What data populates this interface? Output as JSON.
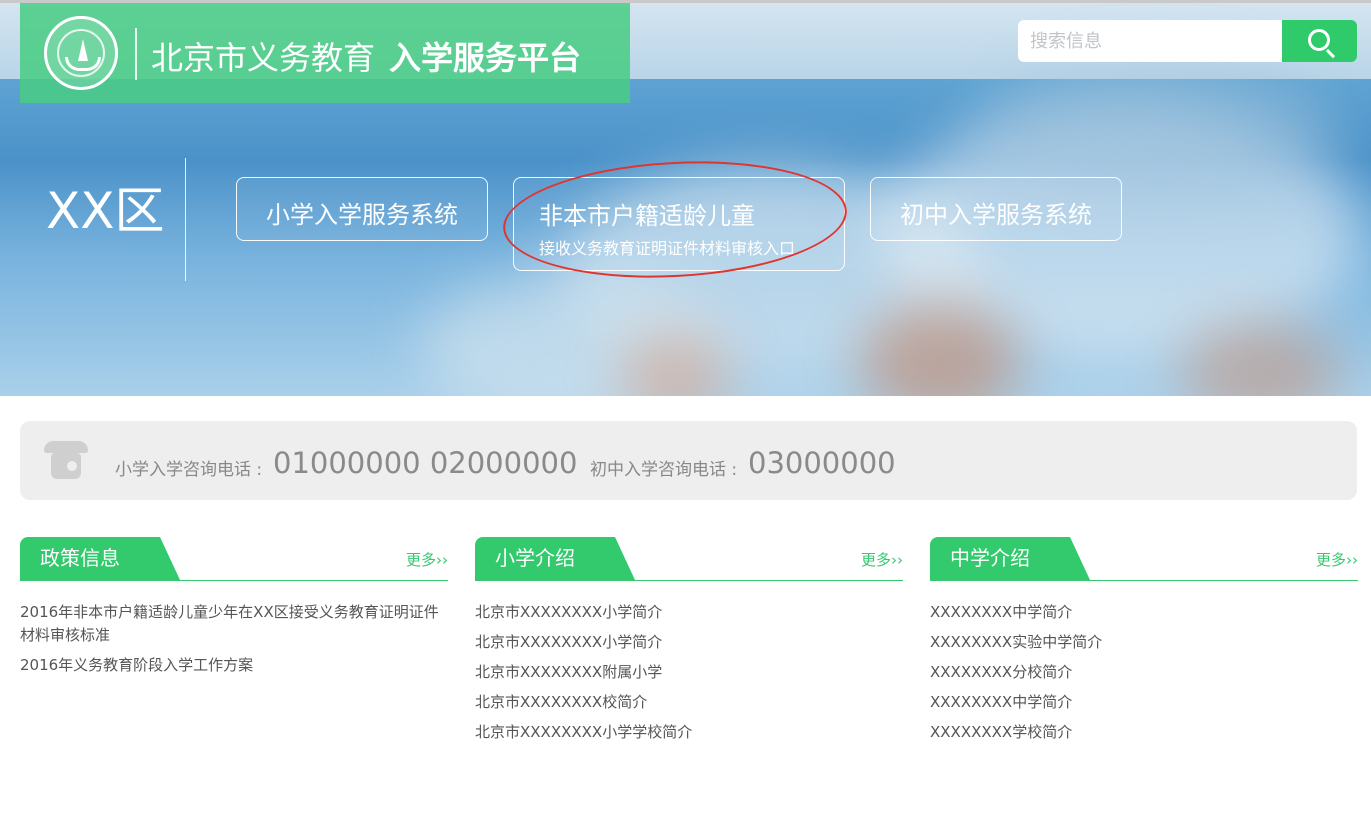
{
  "header": {
    "title_light": "北京市义务教育",
    "title_bold": "入学服务平台",
    "logo_icon": "education-tree-logo",
    "search": {
      "placeholder": "搜索信息",
      "value": ""
    }
  },
  "banner": {
    "district": "XX区",
    "buttons": [
      {
        "label": "小学入学服务系统"
      },
      {
        "label": "非本市户籍适龄儿童",
        "sublabel": "接收义务教育证明证件材料审核入口",
        "annotation": "red-circle"
      },
      {
        "label": "初中入学服务系统"
      }
    ]
  },
  "contact": {
    "icon": "telephone-icon",
    "primary_label": "小学入学咨询电话 :",
    "primary_numbers": "01000000 02000000",
    "middle_label": "初中入学咨询电话 :",
    "middle_number": "03000000"
  },
  "sections": [
    {
      "title": "政策信息",
      "more": "更多››",
      "items": [
        "2016年非本市户籍适龄儿童少年在XX区接受义务教育证明证件材料审核标准",
        "2016年义务教育阶段入学工作方案"
      ]
    },
    {
      "title": "小学介绍",
      "more": "更多››",
      "items": [
        "北京市XXXXXXXX小学简介",
        "北京市XXXXXXXX小学简介",
        "北京市XXXXXXXX附属小学",
        "北京市XXXXXXXX校简介",
        "北京市XXXXXXXX小学学校简介"
      ]
    },
    {
      "title": "中学介绍",
      "more": "更多››",
      "items": [
        "XXXXXXXX中学简介",
        "XXXXXXXX实验中学简介",
        "XXXXXXXX分校简介",
        "XXXXXXXX中学简介",
        "XXXXXXXX学校简介"
      ]
    }
  ],
  "colors": {
    "accent": "#33c96d",
    "annotation": "#e0342e",
    "contact_bg": "#eeeeee"
  }
}
